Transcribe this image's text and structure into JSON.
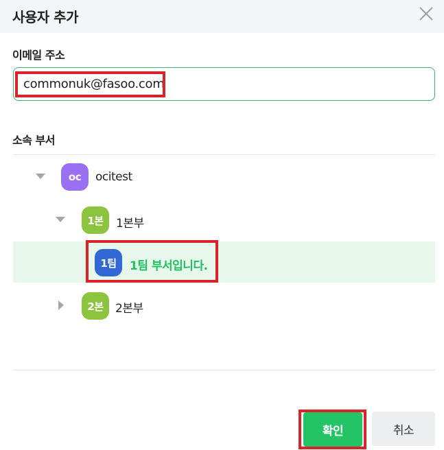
{
  "dialog": {
    "title": "사용자 추가",
    "close_icon": "close-icon"
  },
  "email": {
    "label": "이메일 주소",
    "value": "commonuk@fasoo.com"
  },
  "department": {
    "label": "소속 부서",
    "tree": [
      {
        "avatar": "oc",
        "label": "ocitest",
        "color": "#9b6ff2",
        "expanded": true
      },
      {
        "avatar": "1본",
        "label": "1본부",
        "color": "#8dc43f",
        "expanded": true
      },
      {
        "avatar": "1팀",
        "label": "1팀 부서입니다.",
        "color": "#3267d6",
        "selected": true
      },
      {
        "avatar": "2본",
        "label": "2본부",
        "color": "#8dc43f",
        "expanded": false
      }
    ]
  },
  "buttons": {
    "confirm": "확인",
    "cancel": "취소"
  },
  "colors": {
    "accent_green": "#22c465",
    "highlight_red": "#d8232a",
    "selected_row_bg": "#e7f7ec"
  }
}
